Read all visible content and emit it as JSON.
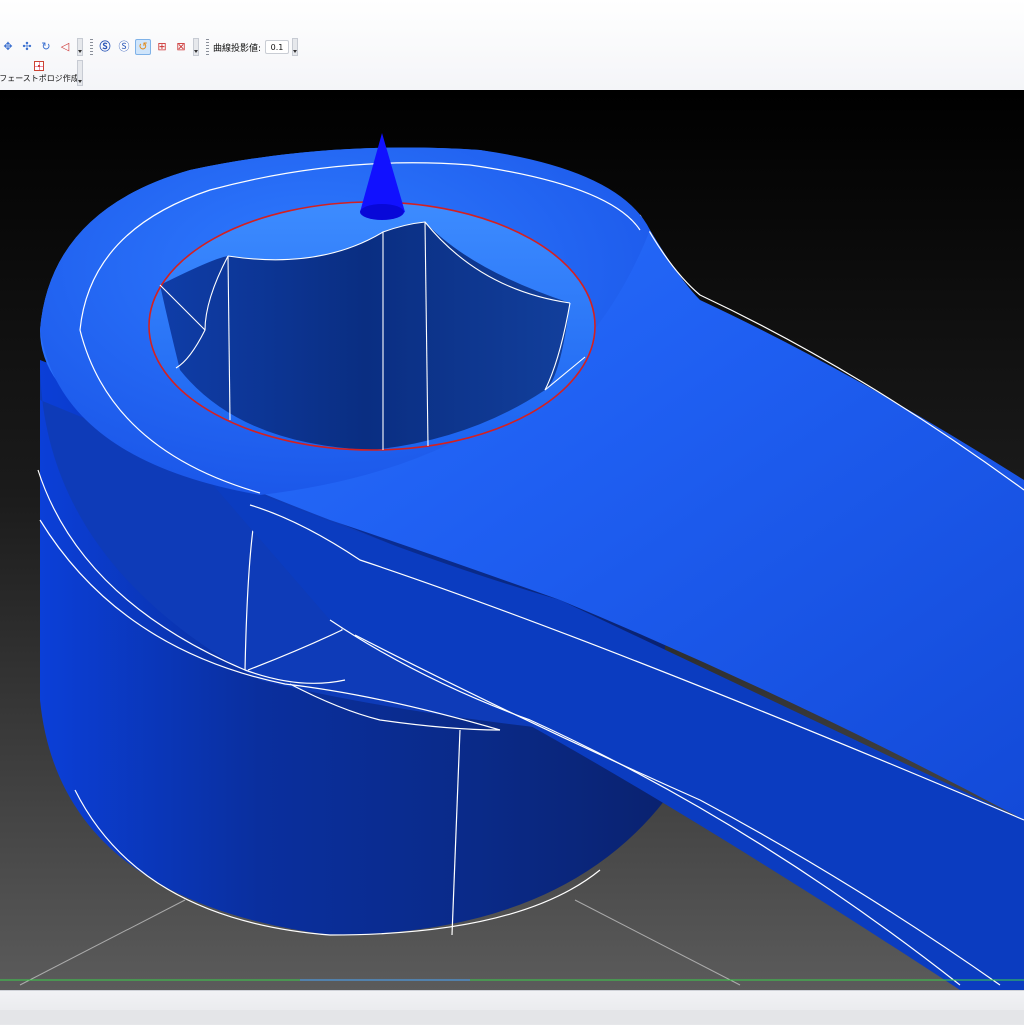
{
  "toolbar": {
    "icons": [
      "move-icon",
      "transform-icon",
      "rotate-icon",
      "lasso-icon",
      "snap-auto-icon",
      "snap-surface-icon",
      "refresh-icon",
      "mesh-grid-icon",
      "mesh-grid-delete-icon"
    ],
    "curve_projection_label": "曲線投影値:",
    "curve_projection_value": "0.1",
    "face_topology_label": "フェーストポロジ作成"
  },
  "colors": {
    "model_blue": "#1f5ff2",
    "edge_white": "#ffffff",
    "boundary_red": "#d42020",
    "background_top": "#000000",
    "background_bottom": "#5a5a5a",
    "grid_green": "#3bd04a"
  }
}
